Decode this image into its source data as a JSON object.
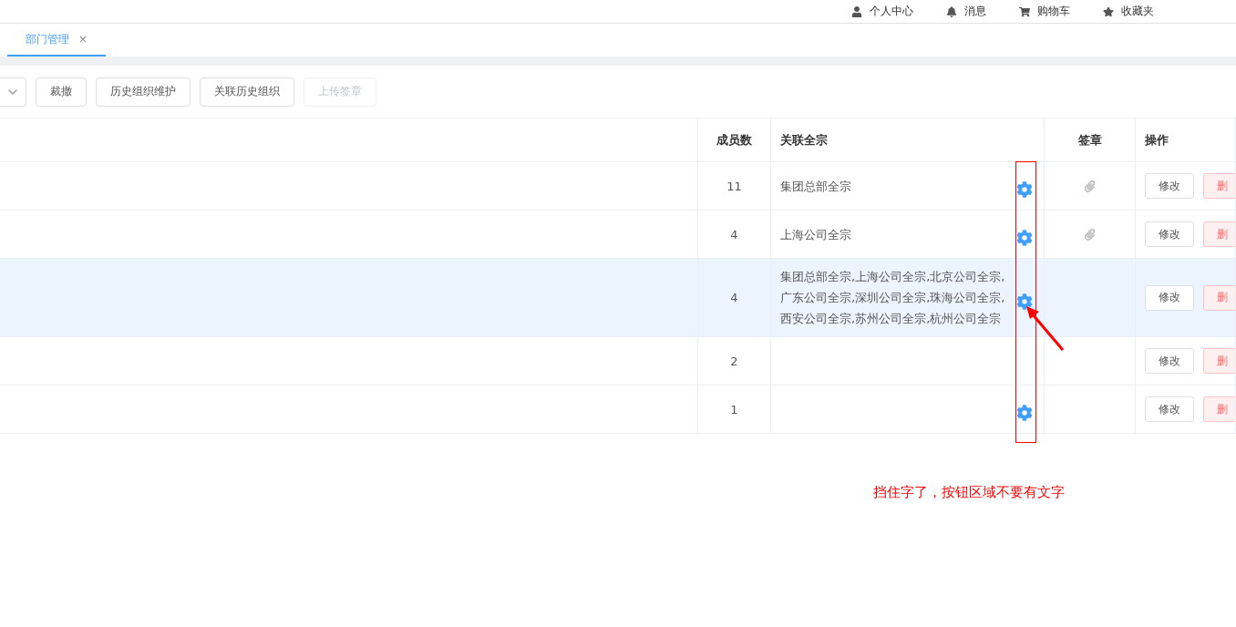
{
  "header": {
    "items": [
      {
        "kind": "user",
        "label": "个人中心"
      },
      {
        "kind": "bell",
        "label": "消息"
      },
      {
        "kind": "cart",
        "label": "购物车"
      },
      {
        "kind": "star",
        "label": "收藏夹"
      }
    ]
  },
  "tabs": [
    {
      "label": "部门管理",
      "close": "×",
      "selected": true
    }
  ],
  "toolbar": {
    "buttons": [
      {
        "label": "裁撤",
        "disabled": false
      },
      {
        "label": "历史组织维护",
        "disabled": false
      },
      {
        "label": "关联历史组织",
        "disabled": false
      },
      {
        "label": "上传签章",
        "disabled": true
      }
    ]
  },
  "table": {
    "columns": [
      "成员数",
      "关联全宗",
      "签章",
      "操作"
    ],
    "rows": [
      {
        "members": "11",
        "fonds": "集团总部全宗",
        "gear": true,
        "seal": true,
        "highlighted": false,
        "edit": "修改",
        "delete": "删"
      },
      {
        "members": "4",
        "fonds": "上海公司全宗",
        "gear": true,
        "seal": true,
        "highlighted": false,
        "edit": "修改",
        "delete": "删"
      },
      {
        "members": "4",
        "fonds": "集团总部全宗,上海公司全宗,北京公司全宗,广东公司全宗,深圳公司全宗,珠海公司全宗,西安公司全宗,苏州公司全宗,杭州公司全宗",
        "gear": true,
        "seal": false,
        "highlighted": true,
        "edit": "修改",
        "delete": "删"
      },
      {
        "members": "2",
        "fonds": "",
        "gear": false,
        "seal": false,
        "highlighted": false,
        "edit": "修改",
        "delete": "删"
      },
      {
        "members": "1",
        "fonds": "",
        "gear": true,
        "seal": false,
        "highlighted": false,
        "edit": "修改",
        "delete": "删"
      }
    ]
  },
  "annotation": {
    "note": "挡住字了，按钮区域不要有文字"
  }
}
